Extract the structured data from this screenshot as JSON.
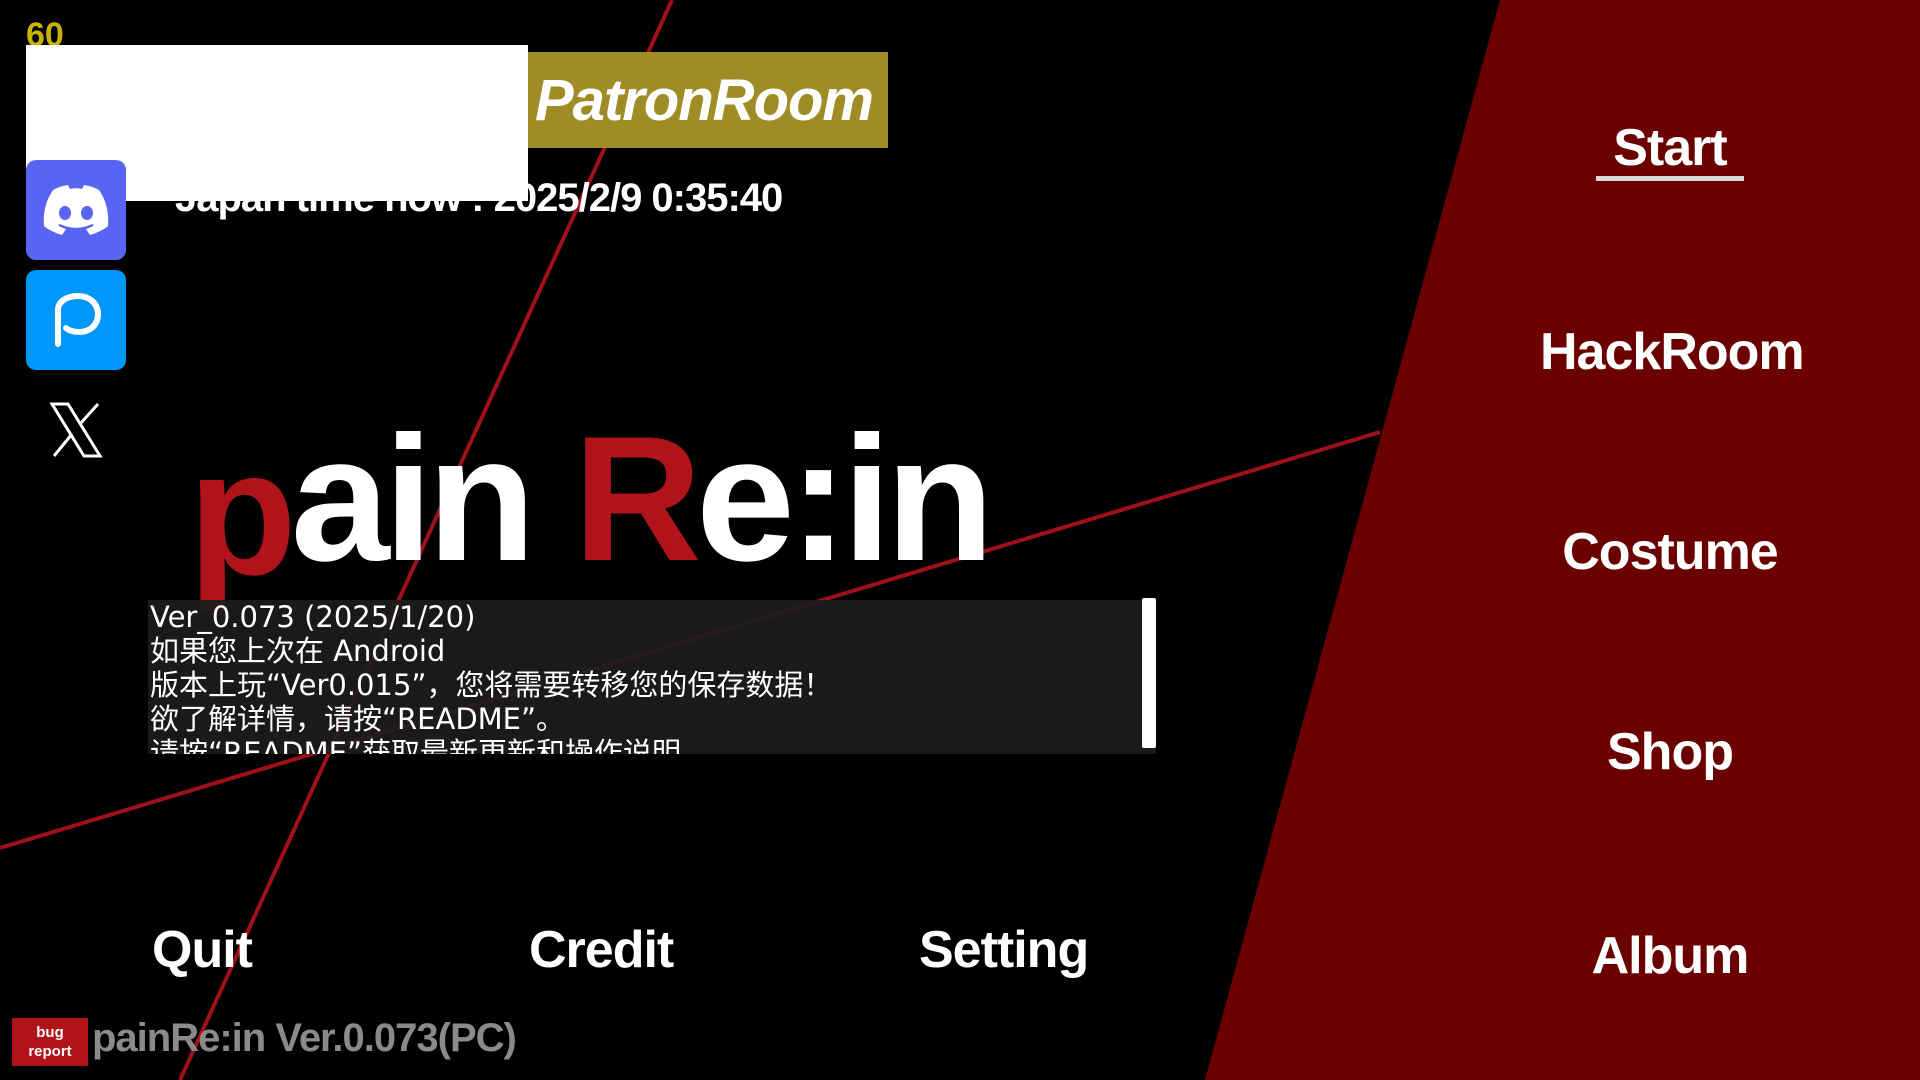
{
  "fps": "60",
  "patron_room": "PatronRoom",
  "japan_time": "Japan time now : 2025/2/9 0:35:40",
  "logo": {
    "part1": "p",
    "part2": "ain ",
    "part3": "R",
    "part4": "e:in"
  },
  "notice": {
    "lines": [
      "Ver_0.073 (2025/1/20)",
      "如果您上次在 Android",
      "版本上玩“Ver0.015”，您将需要转移您的保存数据！",
      "欲了解详情，请按“README”。",
      "请按“README”获取最新更新和操作说明"
    ]
  },
  "bottom_menu": {
    "quit": "Quit",
    "credit": "Credit",
    "setting": "Setting"
  },
  "side_menu": {
    "start": "Start",
    "hackroom": "HackRoom",
    "costume": "Costume",
    "shop": "Shop",
    "album": "Album"
  },
  "bug_report": {
    "line1": "bug",
    "line2": "report"
  },
  "version_footer": "painRe:in Ver.0.073(PC)",
  "colors": {
    "accent_red": "#b0131a",
    "panel_red": "#6b0000",
    "patron_gold": "#a08c26",
    "fps_yellow": "#c8b400"
  },
  "icons": {
    "discord": "discord-icon",
    "pixiv": "pixiv-icon",
    "x": "x-icon"
  }
}
